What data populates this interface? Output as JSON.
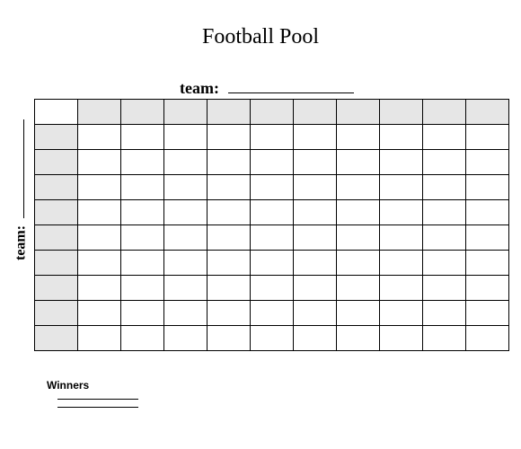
{
  "title": "Football Pool",
  "team_label_top": "team:",
  "team_label_left": "team:",
  "winners_label": "Winners",
  "grid": {
    "rows": 10,
    "cols": 11
  }
}
